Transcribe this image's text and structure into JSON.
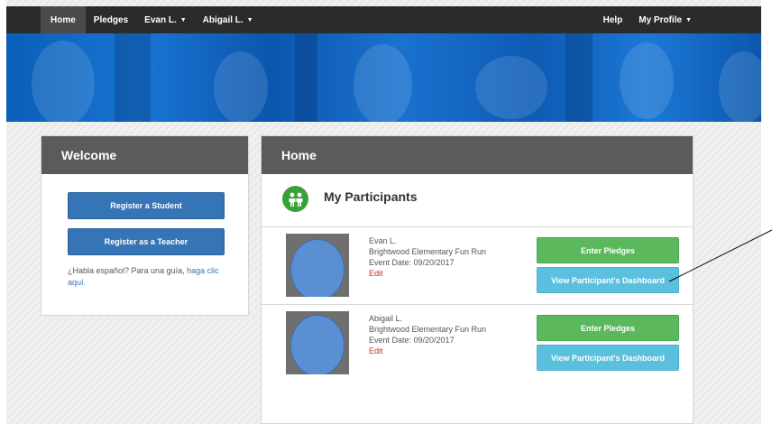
{
  "nav": {
    "home": "Home",
    "pledges": "Pledges",
    "evan": "Evan L.",
    "abigail": "Abigail L.",
    "help": "Help",
    "profile": "My Profile"
  },
  "welcome": {
    "title": "Welcome",
    "register_student": "Register a Student",
    "register_teacher": "Register as a Teacher",
    "habla_text": "¿Habla español? Para una guía, ",
    "habla_link": "haga clic aquí."
  },
  "home": {
    "title": "Home",
    "section_title": "My Participants",
    "participants": [
      {
        "name": "Evan L.",
        "event": "Brightwood Elementary Fun Run",
        "date": "Event Date: 09/20/2017",
        "edit": "Edit",
        "pledge_btn": "Enter Pledges",
        "dashboard_btn": "View Participant's Dashboard"
      },
      {
        "name": "Abigail L.",
        "event": "Brightwood Elementary Fun Run",
        "date": "Event Date: 09/20/2017",
        "edit": "Edit",
        "pledge_btn": "Enter Pledges",
        "dashboard_btn": "View Participant's Dashboard"
      }
    ]
  },
  "colors": {
    "nav_bg": "#2b2b2b",
    "panel_head": "#5b5b5b",
    "primary_blue": "#3574b5",
    "success_green": "#5cb85c",
    "info_cyan": "#5bc0de",
    "edit_red": "#c9302c"
  }
}
